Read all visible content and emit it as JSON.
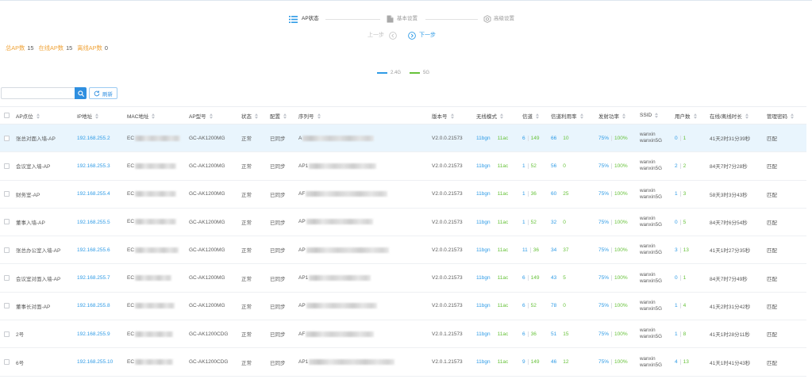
{
  "steps": [
    {
      "label": "AP状态",
      "icon": "list-icon",
      "active": true
    },
    {
      "label": "基本设置",
      "icon": "document-icon",
      "active": false
    },
    {
      "label": "高级设置",
      "icon": "gear-icon",
      "active": false
    }
  ],
  "nav": {
    "prev_label": "上一步",
    "prev_icon": "circle-arrow-left-icon",
    "next_label": "下一步",
    "next_icon": "circle-arrow-right-icon"
  },
  "summary": {
    "total_label": "总AP数",
    "total": "15",
    "online_label": "在线AP数",
    "online": "15",
    "offline_label": "离线AP数",
    "offline": "0"
  },
  "legend": [
    {
      "label": "2.4G",
      "color": "#2f9be6"
    },
    {
      "label": "5G",
      "color": "#67c23a"
    }
  ],
  "toolbar": {
    "search_icon": "search-icon",
    "refresh_label": "刷新",
    "refresh_icon": "refresh-icon"
  },
  "table": {
    "columns": [
      "AP点位",
      "IP地址",
      "MAC地址",
      "AP型号",
      "状态",
      "配置",
      "序列号",
      "版本号",
      "无线模式",
      "信道",
      "信道利用率",
      "发射功率",
      "SSID",
      "用户数",
      "在线/离线时长",
      "管理密码"
    ],
    "rows": [
      {
        "name": "张总对面入墙-AP",
        "ip": "192.168.255.2",
        "mac": "EC",
        "model": "GC-AK1200MG",
        "status": "正常",
        "config": "已同步",
        "serial": "A",
        "version": "V2.0.0.21573",
        "mode_24": "11bgn",
        "mode_5": "11ac",
        "channel_24": "6",
        "channel_5": "149",
        "util_24": "66",
        "util_5": "10",
        "power_24": "75%",
        "power_5": "100%",
        "ssid_24": "wanxin",
        "ssid_5": "wanxin5G",
        "users_24": "0",
        "users_5": "1",
        "uptime": "41天2时31分39秒",
        "password": "匹配",
        "highlighted": true
      },
      {
        "name": "会议室入墙-AP",
        "ip": "192.168.255.3",
        "mac": "EC",
        "model": "GC-AK1200MG",
        "status": "正常",
        "config": "已同步",
        "serial": "AP1",
        "version": "V2.0.0.21573",
        "mode_24": "11bgn",
        "mode_5": "11ac",
        "channel_24": "1",
        "channel_5": "52",
        "util_24": "56",
        "util_5": "0",
        "power_24": "75%",
        "power_5": "100%",
        "ssid_24": "wanxin",
        "ssid_5": "wanxin5G",
        "users_24": "2",
        "users_5": "2",
        "uptime": "84天7时7分28秒",
        "password": "匹配"
      },
      {
        "name": "财务室-AP",
        "ip": "192.168.255.4",
        "mac": "EC",
        "model": "GC-AK1200MG",
        "status": "正常",
        "config": "已同步",
        "serial": "AF",
        "version": "V2.0.0.21573",
        "mode_24": "11bgn",
        "mode_5": "11ac",
        "channel_24": "1",
        "channel_5": "36",
        "util_24": "60",
        "util_5": "25",
        "power_24": "75%",
        "power_5": "100%",
        "ssid_24": "wanxin",
        "ssid_5": "wanxin5G",
        "users_24": "1",
        "users_5": "3",
        "uptime": "58天3时3分43秒",
        "password": "匹配"
      },
      {
        "name": "董事入墙-AP",
        "ip": "192.168.255.5",
        "mac": "EC",
        "model": "GC-AK1200MG",
        "status": "正常",
        "config": "已同步",
        "serial": "AP",
        "version": "V2.0.0.21573",
        "mode_24": "11bgn",
        "mode_5": "11ac",
        "channel_24": "1",
        "channel_5": "52",
        "util_24": "32",
        "util_5": "0",
        "power_24": "75%",
        "power_5": "100%",
        "ssid_24": "wanxin",
        "ssid_5": "wanxin5G",
        "users_24": "0",
        "users_5": "5",
        "uptime": "84天7时6分54秒",
        "password": "匹配"
      },
      {
        "name": "张总办公室入墙-AP",
        "ip": "192.168.255.6",
        "mac": "EC",
        "model": "GC-AK1200MG",
        "status": "正常",
        "config": "已同步",
        "serial": "AP",
        "version": "V2.0.0.21573",
        "mode_24": "11bgn",
        "mode_5": "11ac",
        "channel_24": "11",
        "channel_5": "36",
        "util_24": "34",
        "util_5": "37",
        "power_24": "75%",
        "power_5": "100%",
        "ssid_24": "wanxin",
        "ssid_5": "wanxin5G",
        "users_24": "3",
        "users_5": "13",
        "uptime": "41天1时27分35秒",
        "password": "匹配"
      },
      {
        "name": "会议室对面入墙-AP",
        "ip": "192.168.255.7",
        "mac": "EC",
        "model": "GC-AK1200MG",
        "status": "正常",
        "config": "已同步",
        "serial": "AP1",
        "version": "V2.0.0.21573",
        "mode_24": "11bgn",
        "mode_5": "11ac",
        "channel_24": "6",
        "channel_5": "149",
        "util_24": "43",
        "util_5": "5",
        "power_24": "75%",
        "power_5": "100%",
        "ssid_24": "wanxin",
        "ssid_5": "wanxin5G",
        "users_24": "0",
        "users_5": "1",
        "uptime": "84天7时7分49秒",
        "password": "匹配"
      },
      {
        "name": "董事长对面-AP",
        "ip": "192.168.255.8",
        "mac": "EC",
        "model": "GC-AK1200MG",
        "status": "正常",
        "config": "已同步",
        "serial": "AP",
        "version": "V2.0.0.21573",
        "mode_24": "11bgn",
        "mode_5": "11ac",
        "channel_24": "6",
        "channel_5": "52",
        "util_24": "78",
        "util_5": "0",
        "power_24": "75%",
        "power_5": "100%",
        "ssid_24": "wanxin",
        "ssid_5": "wanxin5G",
        "users_24": "1",
        "users_5": "4",
        "uptime": "41天2时31分42秒",
        "password": "匹配"
      },
      {
        "name": "2号",
        "ip": "192.168.255.9",
        "mac": "EC",
        "model": "GC-AK1200CDG",
        "status": "正常",
        "config": "已同步",
        "serial": "AF",
        "version": "V2.0.1.21573",
        "mode_24": "11bgn",
        "mode_5": "11ac",
        "channel_24": "6",
        "channel_5": "36",
        "util_24": "51",
        "util_5": "15",
        "power_24": "75%",
        "power_5": "100%",
        "ssid_24": "wanxin",
        "ssid_5": "wanxin5G",
        "users_24": "1",
        "users_5": "8",
        "uptime": "41天1时28分11秒",
        "password": "匹配"
      },
      {
        "name": "6号",
        "ip": "192.168.255.10",
        "mac": "EC",
        "model": "GC-AK1200CDG",
        "status": "正常",
        "config": "已同步",
        "serial": "AP1",
        "version": "V2.0.1.21573",
        "mode_24": "11bgn",
        "mode_5": "11ac",
        "channel_24": "9",
        "channel_5": "149",
        "util_24": "46",
        "util_5": "12",
        "power_24": "75%",
        "power_5": "100%",
        "ssid_24": "wanxin",
        "ssid_5": "wanxin5G",
        "users_24": "4",
        "users_5": "13",
        "uptime": "41天1时41分43秒",
        "password": "匹配"
      }
    ]
  },
  "colors": {
    "accent": "#2f9be6",
    "band_5g": "#67c23a",
    "summary_label": "#f0a43a",
    "row_highlight": "#e9f5fd"
  }
}
